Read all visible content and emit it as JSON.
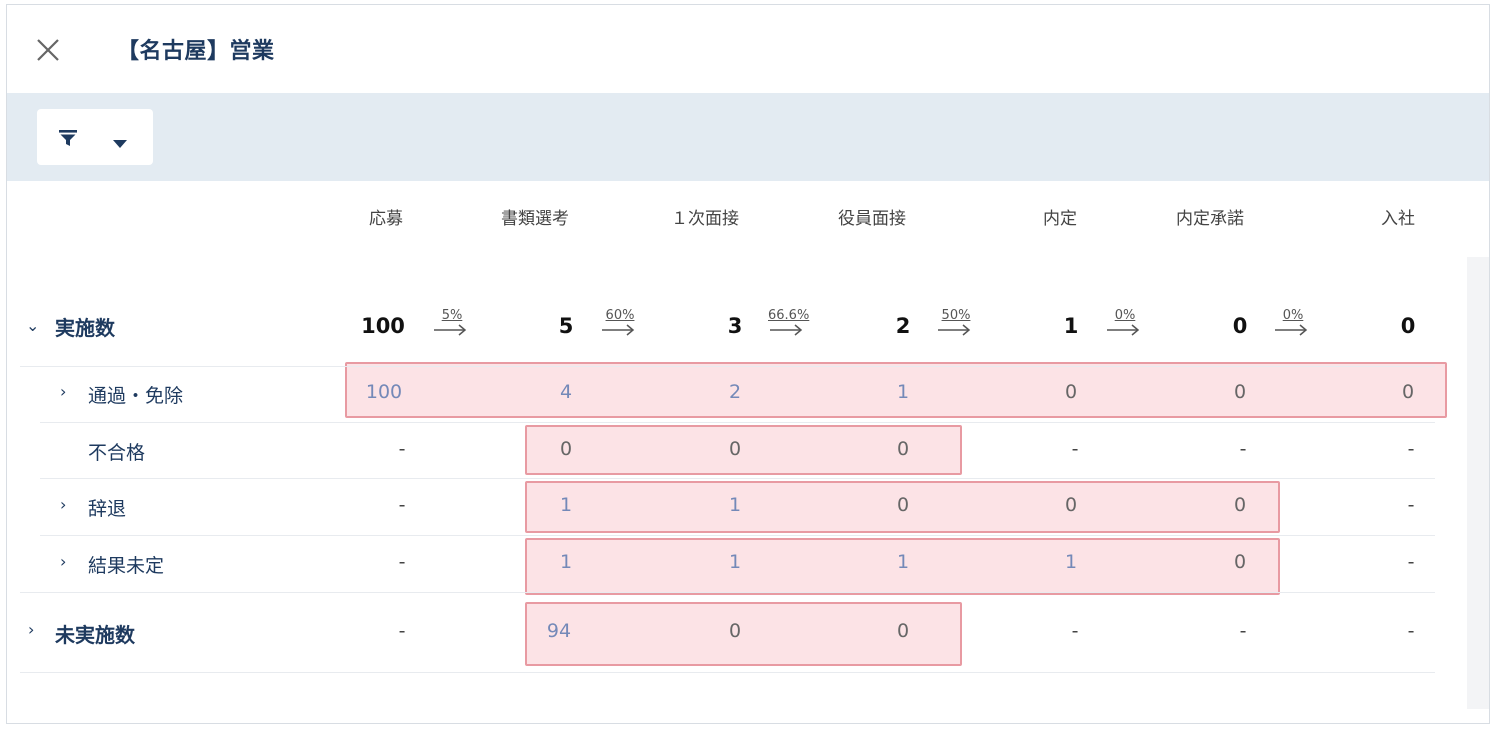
{
  "header": {
    "title": "【名古屋】営業",
    "close_icon": "close-icon"
  },
  "filter": {
    "funnel_icon": "filter-icon",
    "caret_icon": "caret-down-icon"
  },
  "columns": [
    "応募",
    "書類選考",
    "１次面接",
    "役員面接",
    "内定",
    "内定承諾",
    "入社"
  ],
  "rows": {
    "total": {
      "label": "実施数",
      "values": [
        "100",
        "5",
        "3",
        "2",
        "1",
        "0",
        "0"
      ],
      "rates": [
        "5%",
        "60%",
        "66.6%",
        "50%",
        "0%",
        "0%"
      ]
    },
    "pass": {
      "label": "通過・免除",
      "values": [
        "100",
        "4",
        "2",
        "1",
        "0",
        "0",
        "0"
      ]
    },
    "fail": {
      "label": "不合格",
      "values": [
        "-",
        "0",
        "0",
        "0",
        "-",
        "-",
        "-"
      ]
    },
    "decline": {
      "label": "辞退",
      "values": [
        "-",
        "1",
        "1",
        "0",
        "0",
        "0",
        "-"
      ]
    },
    "pending": {
      "label": "結果未定",
      "values": [
        "-",
        "1",
        "1",
        "1",
        "1",
        "0",
        "-"
      ]
    },
    "not_done": {
      "label": "未実施数",
      "values": [
        "-",
        "94",
        "0",
        "0",
        "-",
        "-",
        "-"
      ]
    }
  },
  "colors": {
    "title": "#1e3a5f",
    "link_value": "#7489b8",
    "highlight_border": "#e89aa2",
    "highlight_fill": "#fcdee2",
    "filter_bar": "#e3ebf2"
  }
}
